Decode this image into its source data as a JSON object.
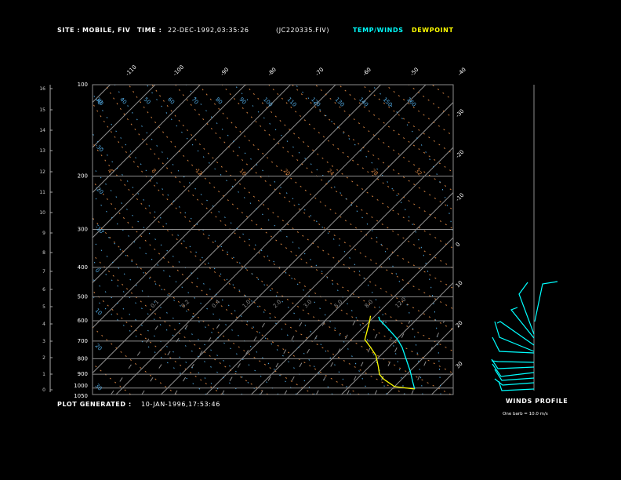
{
  "header": {
    "site_label": "SITE :",
    "site_value": "MOBILE, FIV",
    "time_label": "TIME :",
    "time_value": "22-DEC-1992,03:35:26",
    "file": "(JC220335.FIV)",
    "temp_legend": "TEMP/WINDS",
    "dewpoint_legend": "DEWPOINT"
  },
  "footer": {
    "generated_label": "PLOT GENERATED :",
    "generated_value": "10-JAN-1996,17:53:46"
  },
  "winds": {
    "title": "WINDS PROFILE",
    "note": "One barb = 10.0 m/s"
  },
  "colors": {
    "temp": "#00ffff",
    "dewpoint": "#ffff00",
    "grid": "#8c8c8c",
    "dry_adiabat": "#d08040",
    "moist_adiabat": "#50a8e0",
    "text": "#ffffff"
  },
  "chart_data": {
    "type": "line",
    "subtype": "skew-t log-p",
    "yscale": "log",
    "ylim": [
      1050,
      100
    ],
    "pressure_ticks": [
      "100",
      "200",
      "300",
      "400",
      "500",
      "600",
      "700",
      "800",
      "900",
      "1000",
      "1050"
    ],
    "height_km_ticks": [
      "0",
      "1",
      "2",
      "3",
      "4",
      "5",
      "6",
      "7",
      "8",
      "9",
      "10",
      "11",
      "12",
      "13",
      "14",
      "15",
      "16"
    ],
    "isotherm_top_labels": [
      "-110",
      "-100",
      "-90",
      "-80",
      "-70",
      "-60",
      "-50",
      "-40"
    ],
    "isotherm_right_labels": [
      "-30",
      "-20",
      "-10",
      "0",
      "10",
      "20",
      "30"
    ],
    "moist_adiabat_top_labels": [
      "30",
      "40",
      "50",
      "60",
      "70",
      "80",
      "90",
      "100",
      "110",
      "120",
      "130",
      "140",
      "150",
      "160"
    ],
    "moist_adiabat_left_labels": [
      "-40",
      "-30",
      "-20",
      "-10",
      "0",
      "10",
      "20",
      "30"
    ],
    "dry_adiabat_labels": [
      "4",
      "8",
      "12",
      "16",
      "20",
      "24",
      "28",
      "32"
    ],
    "mixing_ratio_labels": [
      "0.1",
      "0.2",
      "0.4",
      "1.0",
      "2.0",
      "3.0",
      "5.0",
      "8.0",
      "12.0"
    ],
    "series": [
      {
        "name": "TEMP/WINDS",
        "color": "#00ffff",
        "pressure": [
          1007,
          954,
          878,
          813,
          734,
          688,
          640,
          597,
          582
        ],
        "temperature": [
          25,
          23,
          20,
          17,
          13,
          10,
          6,
          2,
          1
        ]
      },
      {
        "name": "DEWPOINT",
        "color": "#ffff00",
        "pressure": [
          1007,
          989,
          935,
          902,
          850,
          781,
          734,
          692,
          602,
          578
        ],
        "temperature": [
          25,
          20,
          16,
          14,
          12,
          9,
          6,
          3,
          0,
          -1
        ]
      }
    ]
  }
}
